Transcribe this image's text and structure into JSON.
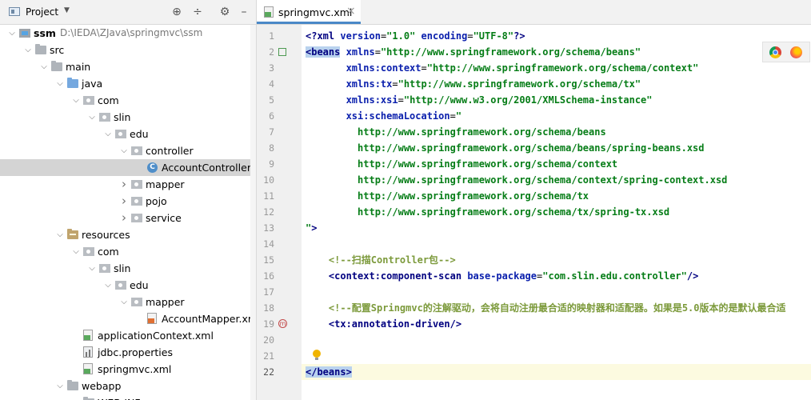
{
  "project_panel": {
    "title": "Project",
    "tree": [
      {
        "label": "ssm",
        "path": "D:\\IEDA\\ZJava\\springmvc\\ssm",
        "icon": "module-folder-icon",
        "level": 0,
        "expanded": true
      },
      {
        "label": "src",
        "icon": "folder-icon",
        "level": 1,
        "expanded": true
      },
      {
        "label": "main",
        "icon": "folder-icon",
        "level": 2,
        "expanded": true
      },
      {
        "label": "java",
        "icon": "source-folder-icon",
        "level": 3,
        "expanded": true
      },
      {
        "label": "com",
        "icon": "package-icon",
        "level": 4,
        "expanded": true
      },
      {
        "label": "slin",
        "icon": "package-icon",
        "level": 5,
        "expanded": true
      },
      {
        "label": "edu",
        "icon": "package-icon",
        "level": 6,
        "expanded": true
      },
      {
        "label": "controller",
        "icon": "package-icon",
        "level": 7,
        "expanded": true
      },
      {
        "label": "AccountController",
        "icon": "class-icon",
        "level": 8,
        "selected": true
      },
      {
        "label": "mapper",
        "icon": "package-icon",
        "level": 7,
        "expanded": false
      },
      {
        "label": "pojo",
        "icon": "package-icon",
        "level": 7,
        "expanded": false
      },
      {
        "label": "service",
        "icon": "package-icon",
        "level": 7,
        "expanded": false
      },
      {
        "label": "resources",
        "icon": "resources-folder-icon",
        "level": 3,
        "expanded": true
      },
      {
        "label": "com",
        "icon": "package-icon",
        "level": 4,
        "expanded": true
      },
      {
        "label": "slin",
        "icon": "package-icon",
        "level": 5,
        "expanded": true
      },
      {
        "label": "edu",
        "icon": "package-icon",
        "level": 6,
        "expanded": true
      },
      {
        "label": "mapper",
        "icon": "package-icon",
        "level": 7,
        "expanded": true
      },
      {
        "label": "AccountMapper.xml",
        "icon": "xml-file-icon",
        "level": 8
      },
      {
        "label": "applicationContext.xml",
        "icon": "spring-xml-icon",
        "level": 4
      },
      {
        "label": "jdbc.properties",
        "icon": "properties-file-icon",
        "level": 4
      },
      {
        "label": "springmvc.xml",
        "icon": "spring-xml-icon",
        "level": 4
      },
      {
        "label": "webapp",
        "icon": "folder-icon",
        "level": 3,
        "expanded": true
      },
      {
        "label": "WEB-INF",
        "icon": "folder-icon",
        "level": 4,
        "expanded": true
      }
    ]
  },
  "editor": {
    "tab_label": "springmvc.xml",
    "line_numbers": [
      "1",
      "2",
      "3",
      "4",
      "5",
      "6",
      "7",
      "8",
      "9",
      "10",
      "11",
      "12",
      "13",
      "14",
      "15",
      "16",
      "17",
      "18",
      "19",
      "20",
      "21",
      "22"
    ],
    "lines": [
      "<?xml version=\"1.0\" encoding=\"UTF-8\"?>",
      "<beans xmlns=\"http://www.springframework.org/schema/beans\"",
      "       xmlns:context=\"http://www.springframework.org/schema/context\"",
      "       xmlns:tx=\"http://www.springframework.org/schema/tx\"",
      "       xmlns:xsi=\"http://www.w3.org/2001/XMLSchema-instance\"",
      "       xsi:schemaLocation=\"",
      "         http://www.springframework.org/schema/beans",
      "         http://www.springframework.org/schema/beans/spring-beans.xsd",
      "         http://www.springframework.org/schema/context",
      "         http://www.springframework.org/schema/context/spring-context.xsd",
      "         http://www.springframework.org/schema/tx",
      "         http://www.springframework.org/schema/tx/spring-tx.xsd",
      "\">",
      "",
      "    <!--扫描Controller包-->",
      "    <context:component-scan base-package=\"com.slin.edu.controller\"/>",
      "",
      "    <!--配置Springmvc的注解驱动，会将自动注册最合适的映射器和适配器。如果是5.0版本的是默认最合适",
      "    <tx:annotation-driven/>",
      "",
      "",
      "</beans>"
    ]
  },
  "colors": {
    "tag": "#000080",
    "attribute": "#0b20ad",
    "value": "#067d17",
    "comment": "#7c9a3b",
    "selection": "#d4d4d4",
    "tab_underline": "#4a88c7"
  }
}
